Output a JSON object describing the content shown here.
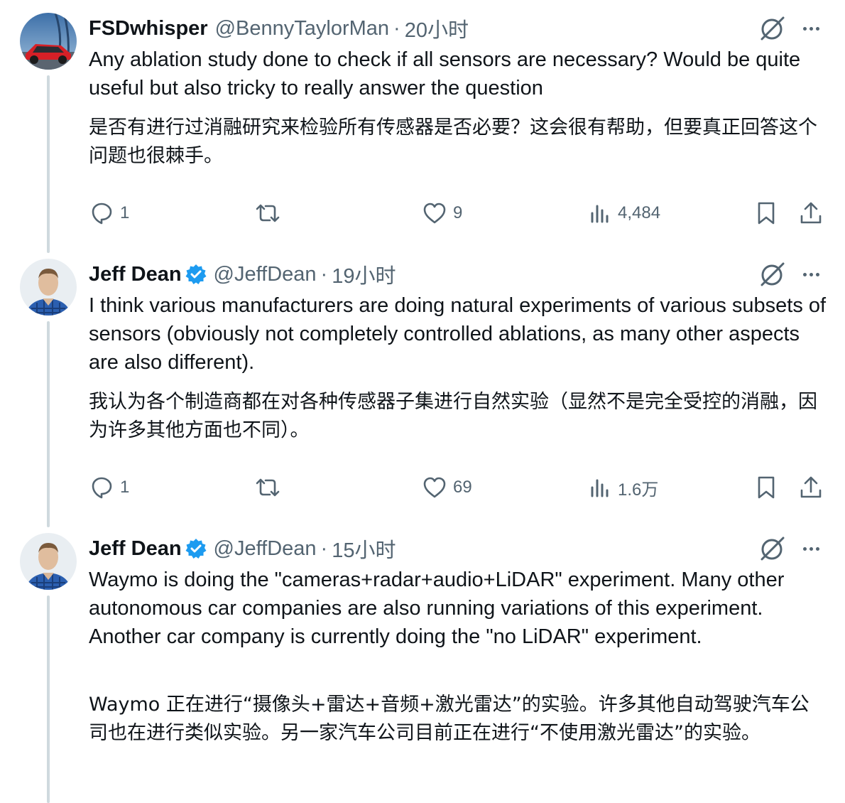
{
  "tweets": [
    {
      "name": "FSDwhisper",
      "handle": "@BennyTaylorMan",
      "separator": "·",
      "time": "20小时",
      "text_en": "Any ablation study done to check if all sensors are necessary? Would be quite useful but also tricky to really answer the question",
      "text_zh": "是否有进行过消融研究来检验所有传感器是否必要？这会很有帮助，但要真正回答这个问题也很棘手。",
      "replies": "1",
      "retweets": "",
      "likes": "9",
      "views": "4,484"
    },
    {
      "name": "Jeff Dean",
      "handle": "@JeffDean",
      "separator": "·",
      "time": "19小时",
      "text_en": "I think various manufacturers are doing natural experiments of various subsets of sensors (obviously not completely controlled ablations, as many other aspects are also different).",
      "text_zh": "我认为各个制造商都在对各种传感器子集进行自然实验（显然不是完全受控的消融，因为许多其他方面也不同）。",
      "replies": "1",
      "retweets": "",
      "likes": "69",
      "views": "1.6万"
    },
    {
      "name": "Jeff Dean",
      "handle": "@JeffDean",
      "separator": "·",
      "time": "15小时",
      "text_en": "Waymo is doing the \"cameras+radar+audio+LiDAR\" experiment.  Many other autonomous car companies are also running variations of this experiment.  Another car company is currently doing the \"no LiDAR\" experiment.",
      "text_zh": "Waymo 正在进行“摄像头+雷达+音频+激光雷达”的实验。许多其他自动驾驶汽车公司也在进行类似实验。另一家汽车公司目前正在进行“不使用激光雷达”的实验。"
    }
  ],
  "colors": {
    "text": "#0f1419",
    "secondary": "#536471",
    "verified": "#1d9bf0",
    "thread_line": "#cfd9de"
  },
  "icons": [
    "reply-icon",
    "retweet-icon",
    "like-icon",
    "views-icon",
    "bookmark-icon",
    "share-icon",
    "grok-icon",
    "more-icon",
    "verified-badge-icon"
  ]
}
